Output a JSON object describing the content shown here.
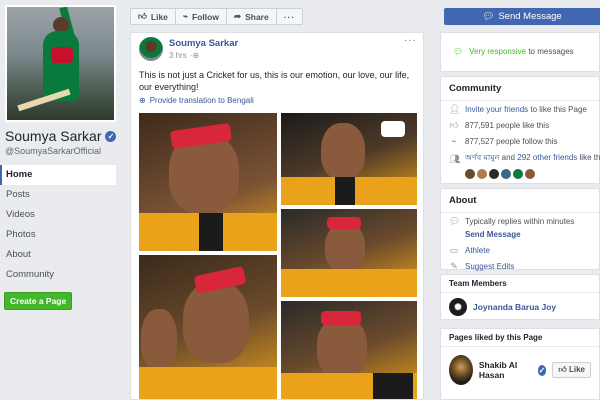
{
  "profile": {
    "name": "Soumya Sarkar",
    "handle": "@SoumyaSarkarOfficial"
  },
  "nav": {
    "items": [
      {
        "label": "Home",
        "active": true
      },
      {
        "label": "Posts"
      },
      {
        "label": "Videos"
      },
      {
        "label": "Photos"
      },
      {
        "label": "About"
      },
      {
        "label": "Community"
      }
    ],
    "create_page_label": "Create a Page"
  },
  "actions": {
    "like_label": "Like",
    "follow_label": "Follow",
    "share_label": "Share",
    "more_label": "···",
    "send_message_label": "Send Message"
  },
  "post": {
    "author": "Soumya Sarkar",
    "time": "3 hrs",
    "text": "This is not just a Cricket for us, this is our emotion, our love, our life, our everything!",
    "translate_label": "Provide translation to Bengali"
  },
  "sidebar": {
    "responsive": {
      "highlight": "Very responsive",
      "rest": "to messages"
    },
    "community": {
      "title": "Community",
      "invite_link": "Invite your friends",
      "invite_rest": "to like this Page",
      "likes": "877,591 people like this",
      "follows": "877,527 people follow this",
      "friends_name": "অর্ণব মামুন",
      "friends_and": "and",
      "friends_count": "292 other friends",
      "friends_rest": "like this"
    },
    "about": {
      "title": "About",
      "reply_text": "Typically replies within minutes",
      "send_message_link": "Send Message",
      "category": "Athlete",
      "suggest_edits": "Suggest Edits"
    },
    "team": {
      "title": "Team Members",
      "member": "Joynanda Barua Joy"
    },
    "pages_liked": {
      "title": "Pages liked by this Page",
      "page_name": "Shakib Al Hasan",
      "like_label": "Like"
    }
  },
  "colors": {
    "brand": "#4267b2",
    "link": "#385898",
    "green": "#42b72a",
    "background": "#e9ebee"
  }
}
